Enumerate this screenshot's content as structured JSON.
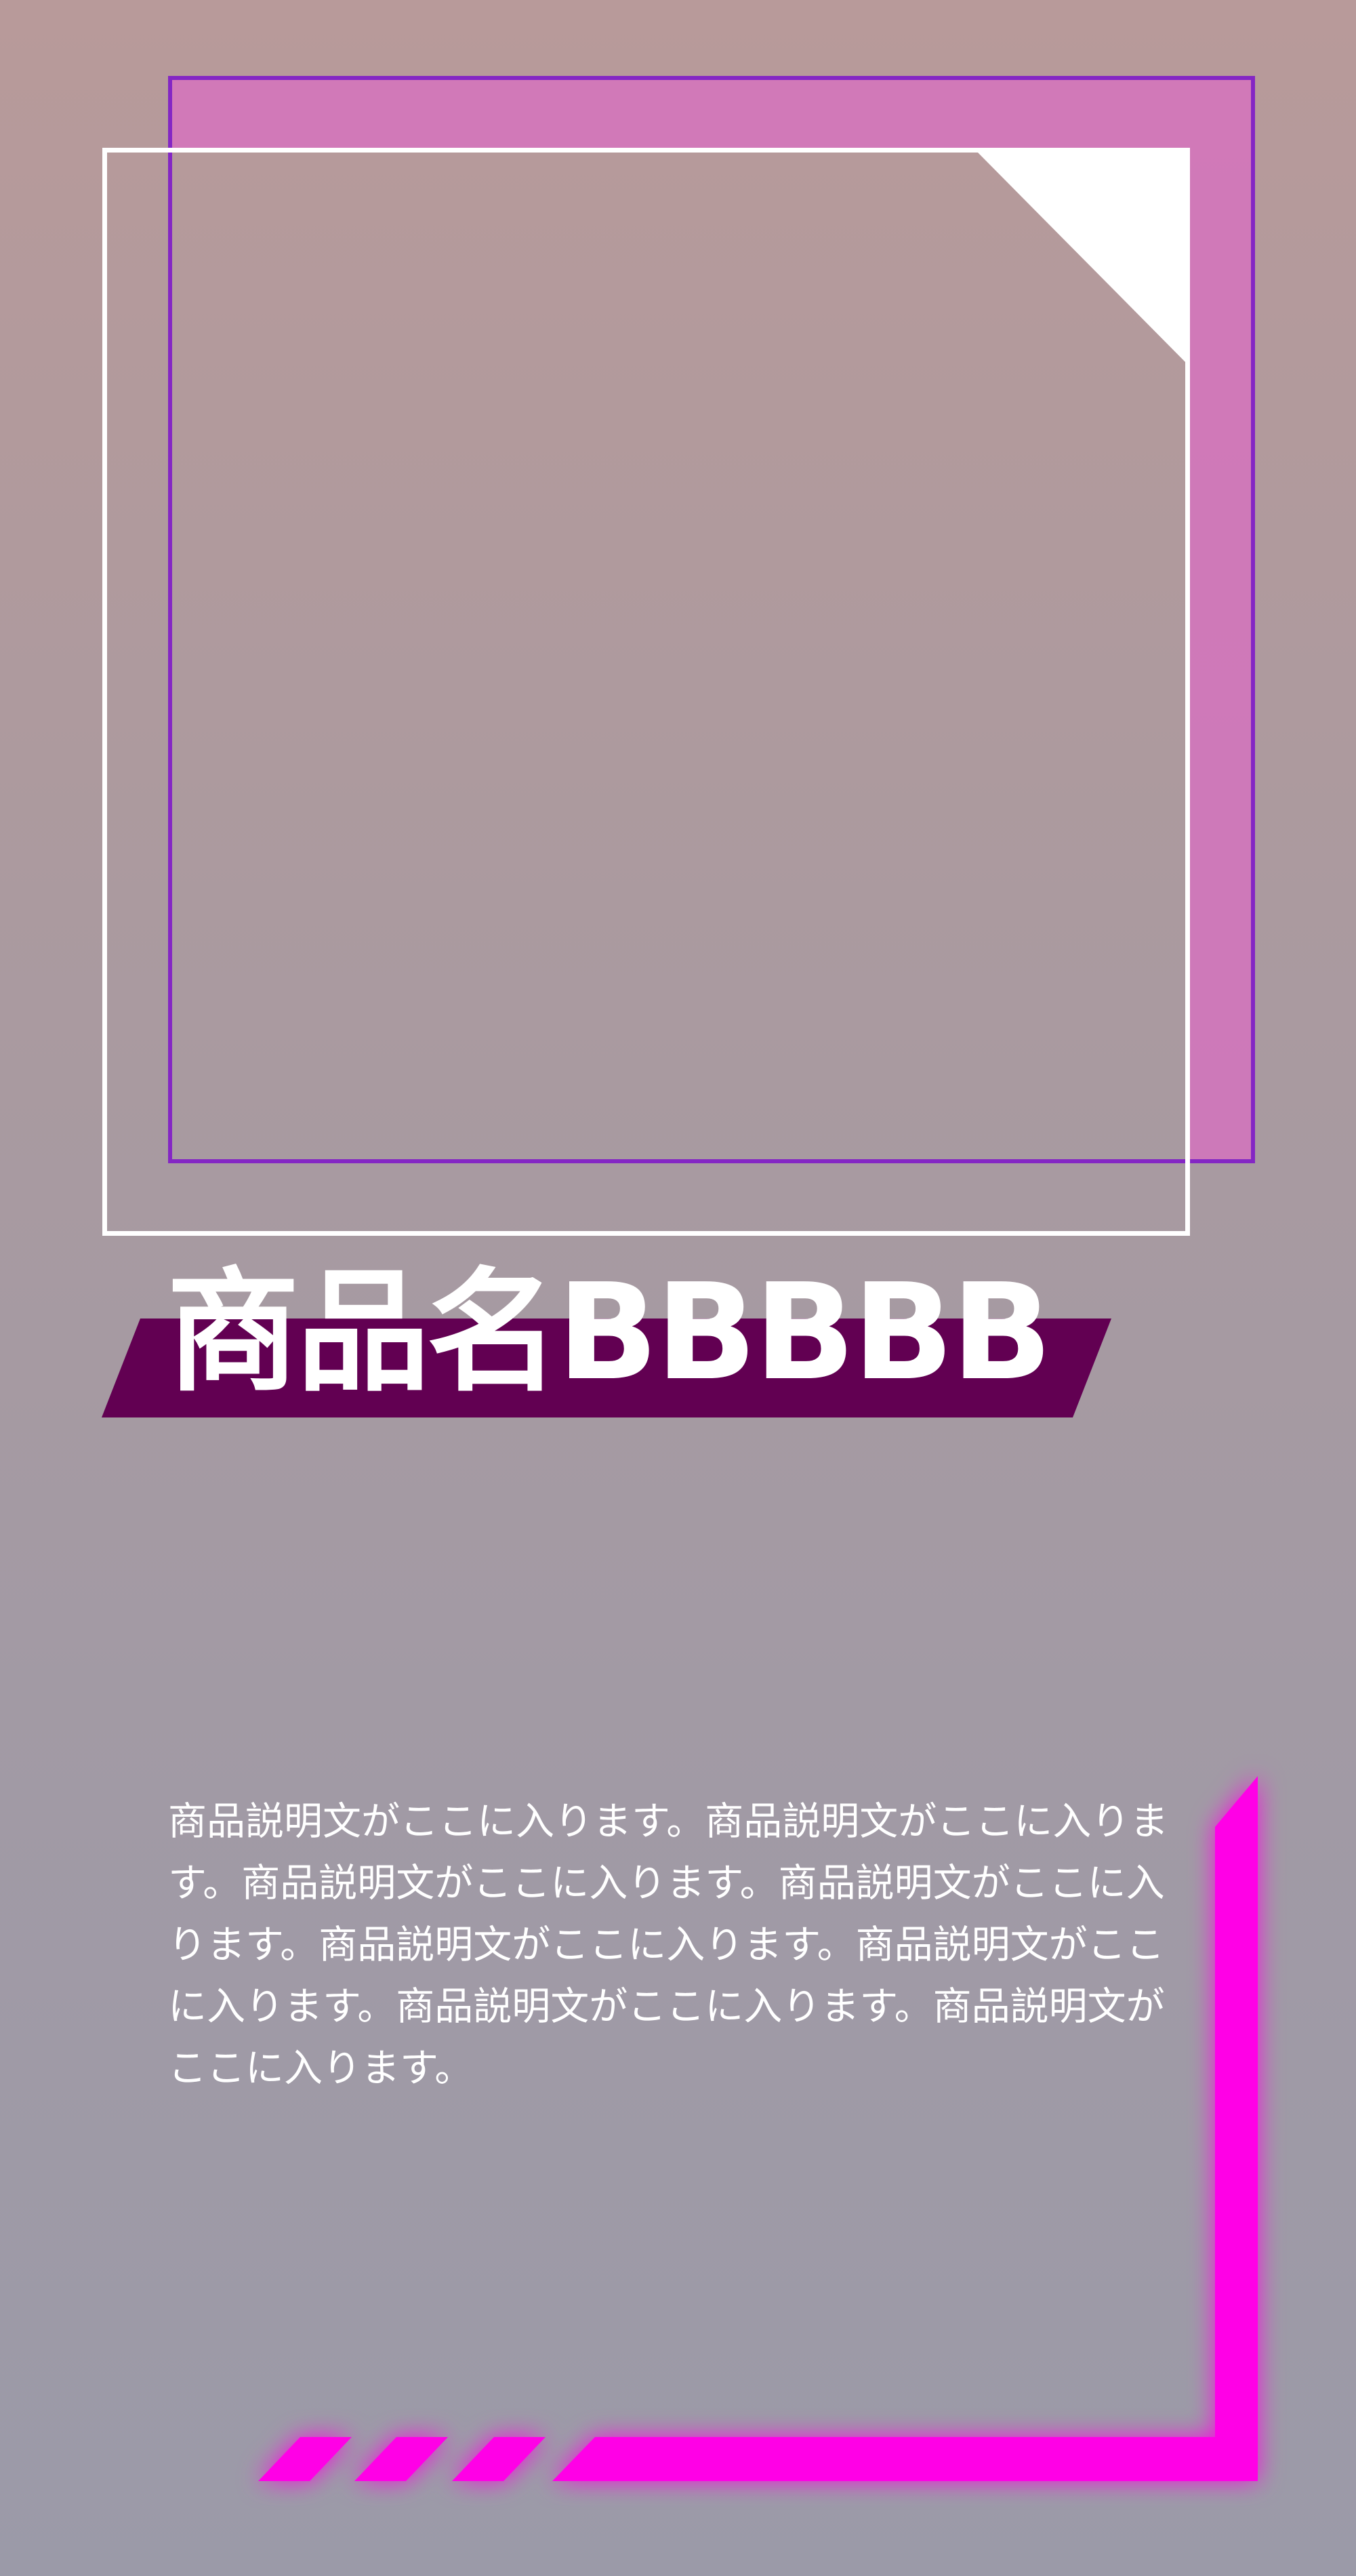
{
  "product": {
    "title": "商品名BBBBB",
    "description": "商品説明文がここに入ります。商品説明文がここに入ります。商品説明文がここに入ります。商品説明文がここに入ります。商品説明文がここに入ります。商品説明文がここに入ります。商品説明文がここに入ります。商品説明文がここに入ります。"
  },
  "colors": {
    "background_top": "#b89a9a",
    "background_bottom": "#9b9aa8",
    "frame_purple": "#8426c4",
    "frame_pink_fill": "#d96ec2",
    "frame_white": "#ffffff",
    "title_banner": "#620052",
    "neon_magenta": "#ff00e6"
  }
}
